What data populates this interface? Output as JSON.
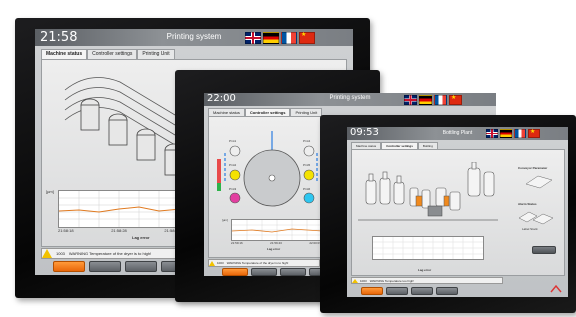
{
  "monitor_1": {
    "time": "21:58",
    "title": "Printing system",
    "tabs": [
      "Machine status",
      "Controller settings",
      "Printing Unit"
    ],
    "chart_unit": "[µm]",
    "y_ticks": [
      "10",
      "5",
      "0",
      "-5",
      "-10"
    ],
    "x_ticks": [
      "21:58:18",
      "21:58:28",
      "21:58:38"
    ],
    "chart_caption": "Lag error",
    "warning_code": "1003",
    "warning_text": "WARNING  Temperature of the dryer is to high!",
    "buttons": [
      "",
      "",
      "",
      ""
    ],
    "flags": [
      "uk",
      "de",
      "fr",
      "cn"
    ]
  },
  "monitor_2": {
    "time": "22:00",
    "title": "Printing system",
    "tabs": [
      "Machine status",
      "Controller settings",
      "Printing Unit"
    ],
    "unit_labels": [
      "Prnt1",
      "Prnt2",
      "Prnt3",
      "Prnt4",
      "Prnt5",
      "Prnt6"
    ],
    "chart_unit": "[µm]",
    "x_ticks": [
      "21:59:16",
      "21:59:43",
      "22:00:03"
    ],
    "chart_caption": "Lag error",
    "warning_code": "1003",
    "warning_text": "WARNING  Temperature of the dryer is to high!",
    "buttons": [
      "",
      "",
      "",
      ""
    ],
    "flags": [
      "uk",
      "de",
      "fr",
      "cn"
    ]
  },
  "monitor_3": {
    "time": "09:53",
    "title": "Bottling Plant",
    "tabs": [
      "Machine status",
      "Controller settings",
      "Bottling"
    ],
    "labels": [
      "Conveyor Parameter",
      "Alarm Status",
      "Label Stock"
    ],
    "chart_caption": "Lag error",
    "warning_code": "1003",
    "warning_text": "WARNING  Temperature too high!",
    "buttons": [
      "",
      "",
      "",
      ""
    ],
    "flags": [
      "uk",
      "de",
      "fr",
      "cn"
    ]
  }
}
